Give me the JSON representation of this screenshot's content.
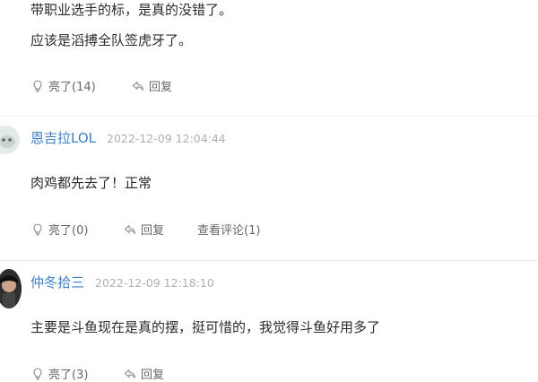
{
  "comments": [
    {
      "lines": [
        "带职业选手的标，是真的没错了。",
        "应该是滔搏全队签虎牙了。"
      ],
      "like_label": "亮了(14)",
      "reply_label": "回复"
    },
    {
      "username": "恩吉拉LOL",
      "timestamp": "2022-12-09 12:04:44",
      "text": "肉鸡都先去了！正常",
      "like_label": "亮了(0)",
      "reply_label": "回复",
      "view_comments_label": "查看评论(1)"
    },
    {
      "username": "仲冬拾三",
      "timestamp": "2022-12-09 12:18:10",
      "text": "主要是斗鱼现在是真的摆，挺可惜的，我觉得斗鱼好用多了",
      "like_label": "亮了(3)",
      "reply_label": "回复"
    }
  ],
  "colors": {
    "username": "#3d7fc4",
    "timestamp": "#b0b0b0",
    "action": "#666666"
  }
}
